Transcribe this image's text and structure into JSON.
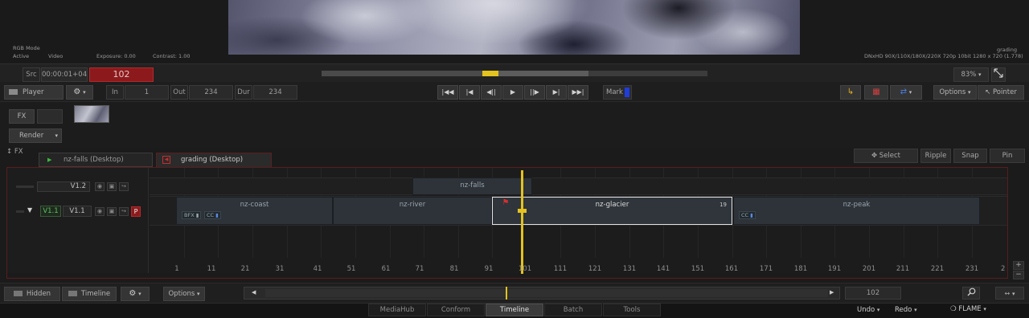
{
  "viewer": {
    "rgb_mode": "RGB Mode",
    "active": "Active",
    "video": "Video",
    "exposure": "Exposure: 0.00",
    "contrast": "Contrast: 1.00",
    "clip_name": "grading",
    "format": "DNxHD 90X/110X/180X/220X 720p 10bit 1280 x 720 (1.778)"
  },
  "transport": {
    "src_label": "Src",
    "timecode": "00:00:01+04",
    "frame": "102",
    "zoom": "83%"
  },
  "toolbar": {
    "player": "Player",
    "in_label": "In",
    "in_value": "1",
    "out_label": "Out",
    "out_value": "234",
    "dur_label": "Dur",
    "dur_value": "234",
    "mark": "Mark",
    "options": "Options",
    "pointer": "Pointer"
  },
  "left_panel": {
    "fx": "FX",
    "render": "Render",
    "fx_toggle": "FX"
  },
  "tabs": [
    {
      "label": "nz-falls (Desktop)"
    },
    {
      "label": "grading (Desktop)"
    }
  ],
  "edit_modes": {
    "select": "Select",
    "ripple": "Ripple",
    "snap": "Snap",
    "pin": "Pin"
  },
  "tracks": {
    "v12": "V1.2",
    "v11_src": "V1.1",
    "v11": "V1.1",
    "primary": "P"
  },
  "segments": {
    "falls": "nz-falls",
    "coast": "nz-coast",
    "river": "nz-river",
    "glacier": "nz-glacier",
    "peak": "nz-peak",
    "glacier_num": "19",
    "bfx": "BFX",
    "cc1": "CC",
    "cc2": "CC"
  },
  "ruler": [
    "1",
    "11",
    "21",
    "31",
    "41",
    "51",
    "61",
    "71",
    "81",
    "91",
    "101",
    "111",
    "121",
    "131",
    "141",
    "151",
    "161",
    "171",
    "181",
    "191",
    "201",
    "211",
    "221",
    "231",
    "2"
  ],
  "bottom": {
    "hidden": "Hidden",
    "timeline": "Timeline",
    "options": "Options",
    "frame": "102"
  },
  "app_tabs": [
    "MediaHub",
    "Conform",
    "Timeline",
    "Batch",
    "Tools"
  ],
  "footer": {
    "undo": "Undo",
    "redo": "Redo",
    "app": "FLAME"
  },
  "colors": {
    "accent_yellow": "#e4c21f",
    "frame_red": "#8c1a1c",
    "mark_blue": "#1f3ddb"
  }
}
